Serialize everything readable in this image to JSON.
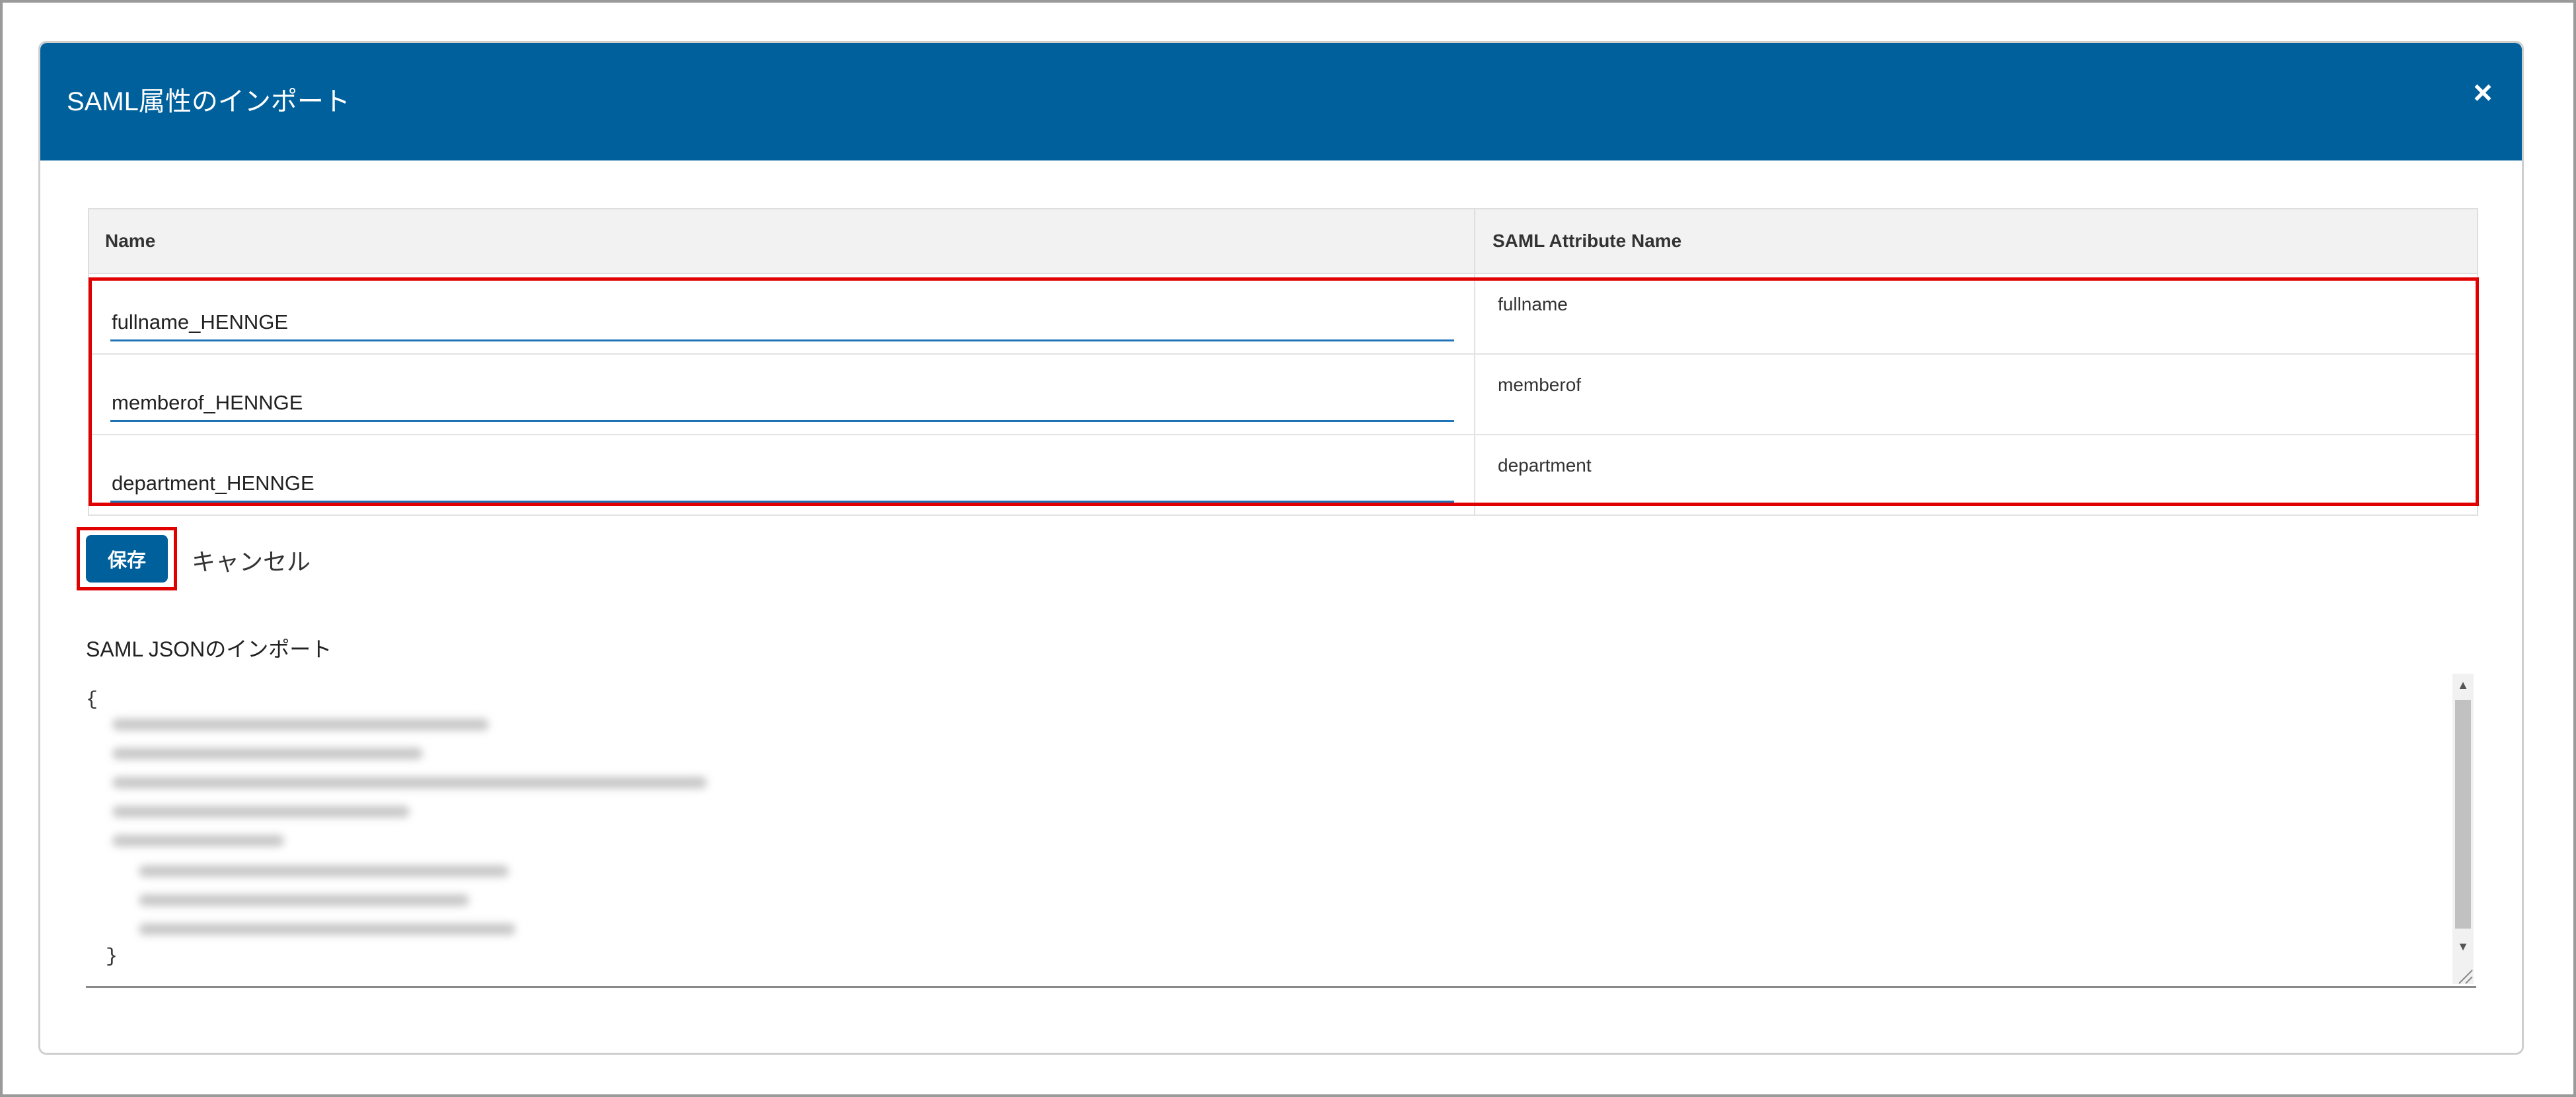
{
  "dialog": {
    "title": "SAML属性のインポート",
    "close_label": "×"
  },
  "table": {
    "headers": {
      "name": "Name",
      "attr": "SAML Attribute Name"
    },
    "rows": [
      {
        "name": "fullname_HENNGE",
        "attr": "fullname"
      },
      {
        "name": "memberof_HENNGE",
        "attr": "memberof"
      },
      {
        "name": "department_HENNGE",
        "attr": "department"
      }
    ]
  },
  "actions": {
    "save_label": "保存",
    "cancel_label": "キャンセル"
  },
  "json_import": {
    "label": "SAML JSONのインポート",
    "open_brace": "{",
    "close_brace": "}"
  },
  "colors": {
    "header_bg": "#00609c",
    "highlight": "#e00000",
    "input_underline": "#1f73b7"
  }
}
